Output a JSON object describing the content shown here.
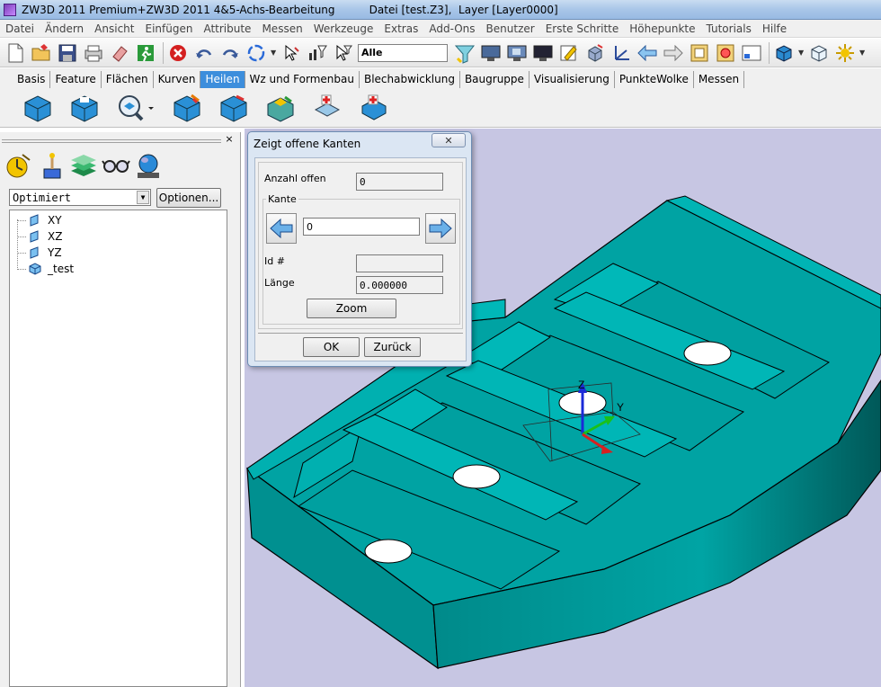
{
  "window": {
    "title": "ZW3D 2011 Premium+ZW3D 2011 4&5-Achs-Bearbeitung          Datei [test.Z3],  Layer [Layer0000]"
  },
  "menubar": {
    "items": [
      "Datei",
      "Ändern",
      "Ansicht",
      "Einfügen",
      "Attribute",
      "Messen",
      "Werkzeuge",
      "Extras",
      "Add-Ons",
      "Benutzer",
      "Erste Schritte",
      "Höhepunkte",
      "Tutorials",
      "Hilfe"
    ]
  },
  "toolbar": {
    "filter_value": "Alle"
  },
  "ribbon_tabs": {
    "items": [
      "Basis",
      "Feature",
      "Flächen",
      "Kurven",
      "Heilen",
      "Wz und Formenbau",
      "Blechabwicklung",
      "Baugruppe",
      "Visualisierung",
      "PunkteWolke",
      "Messen"
    ],
    "active": "Heilen"
  },
  "left_panel": {
    "close_glyph": "×",
    "filter_select": "Optimiert",
    "options_button": "Optionen...",
    "tree": [
      "XY",
      "XZ",
      "YZ",
      "_test"
    ]
  },
  "dialog": {
    "title": "Zeigt offene Kanten",
    "open_count_label": "Anzahl offen",
    "open_count_value": "0",
    "edge_group_label": "Kante",
    "edge_value": "0",
    "id_label": "Id #",
    "id_value": "",
    "length_label": "Länge",
    "length_value": "0.000000",
    "zoom_button": "Zoom",
    "ok_button": "OK",
    "back_button": "Zurück",
    "close_glyph": "✕"
  },
  "viewport": {
    "background": "#c7c6e3",
    "model_color": "#00a0a0",
    "axis_labels": {
      "z": "Z",
      "y": "Y"
    }
  }
}
